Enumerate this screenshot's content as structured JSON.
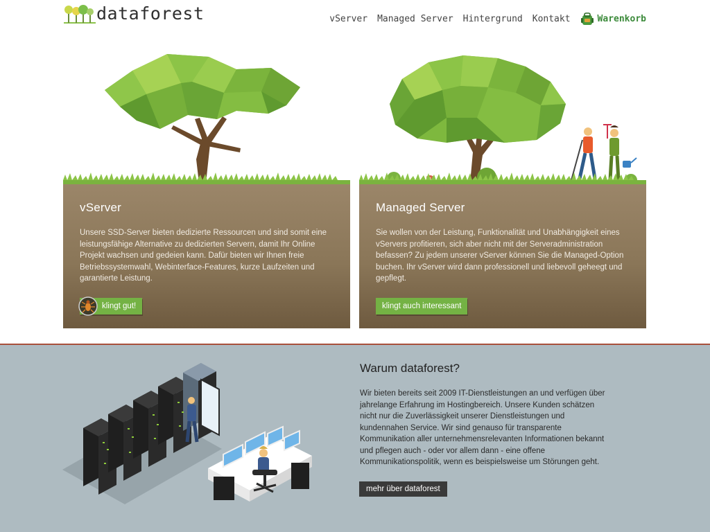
{
  "brand": {
    "logo_text": "dataforest",
    "logo_icon": "tree-group-logo-icon"
  },
  "nav": {
    "items": [
      {
        "label": "vServer"
      },
      {
        "label": "Managed Server"
      },
      {
        "label": "Hintergrund"
      },
      {
        "label": "Kontakt"
      }
    ],
    "cart": {
      "label": "Warenkorb",
      "icon": "backpack-cart-icon"
    }
  },
  "cards": [
    {
      "title": "vServer",
      "text": "Unsere SSD-Server bieten dedizierte Ressourcen und sind somit eine leistungsfähige Alternative zu dedizierten Servern, damit Ihr Online Projekt wachsen und gedeien kann. Dafür bieten wir Ihnen freie Betriebssystemwahl, Webinterface-Features, kurze Laufzeiten und garantierte Leistung.",
      "button_label": "klingt gut!",
      "button_icon": "bug-icon",
      "illustration": "tree-illustration"
    },
    {
      "title": "Managed Server",
      "text": "Sie wollen von der Leistung, Funktionalität und Unabhängigkeit eines vServers profitieren, sich aber nicht mit der Serveradministration befassen? Zu jedem unserer vServer können Sie die Managed-Option buchen. Ihr vServer wird dann professionell und liebevoll geheegt und gepflegt.",
      "button_label": "klingt auch interessant",
      "illustration": "tree-with-gardeners-illustration"
    }
  ],
  "about": {
    "title": "Warum dataforest?",
    "text": "Wir bieten bereits seit 2009 IT-Dienstleistungen an und verfügen über jahrelange Erfahrung im Hostingbereich. Unsere Kunden schätzen nicht nur die Zuverlässigkeit unserer Dienstleistungen und kundennahen Service. Wir sind genauso für transparente Kommunikation aller unternehmensrelevanten Informationen bekannt und pflegen auch - oder vor allem dann - eine offene Kommunikationspolitik, wenn es beispielsweise um Störungen geht.",
    "button_label": "mehr über dataforest",
    "illustration": "datacenter-illustration"
  },
  "colors": {
    "accent_green": "#74b244",
    "cart_green": "#3b8a3a",
    "card_brown": "#8a7658",
    "divider_red": "#a84f3a",
    "about_bg": "#aebbc1",
    "dark_button": "#3a3a3a"
  }
}
